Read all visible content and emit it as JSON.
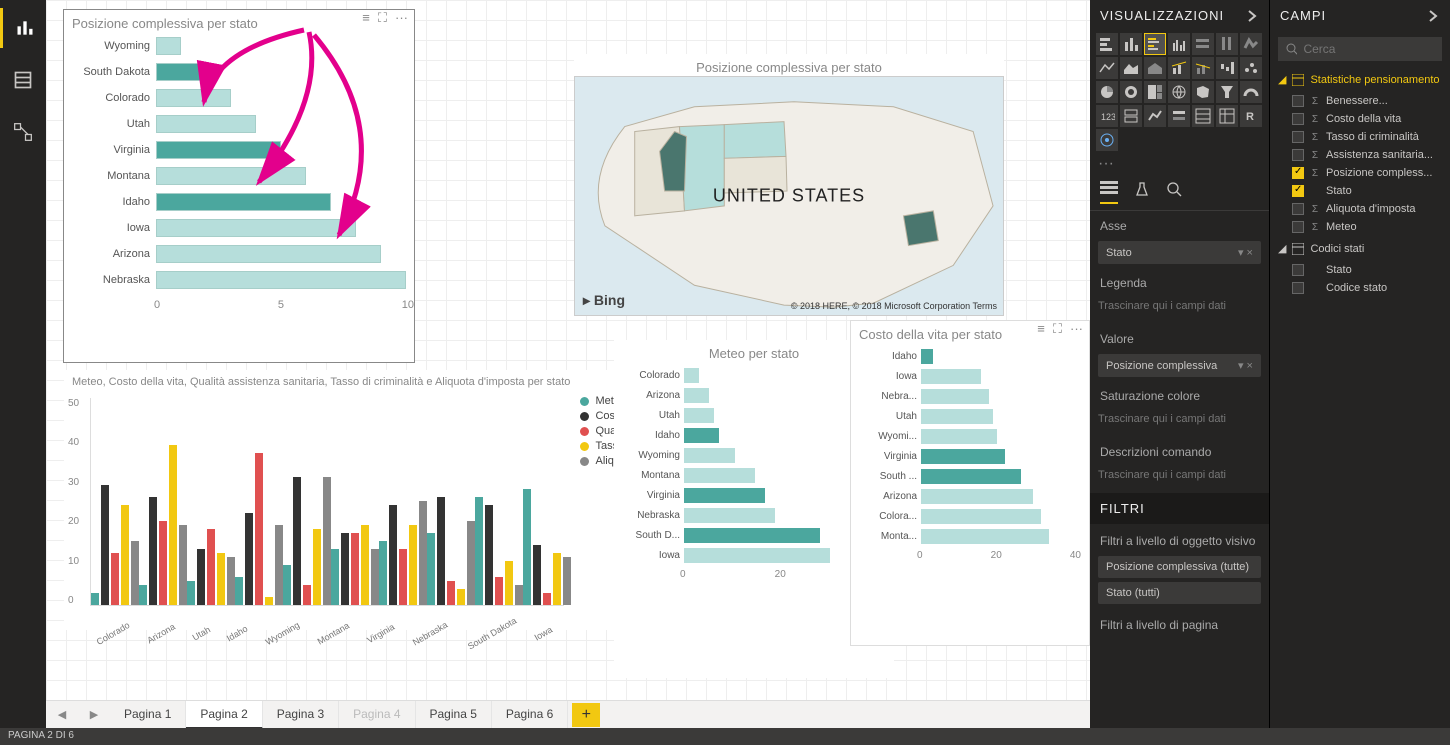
{
  "leftRail": {
    "items": [
      "report",
      "data",
      "model"
    ]
  },
  "visualizations": {
    "title": "VISUALIZZAZIONI",
    "more": "···"
  },
  "vizTabs": [
    "fields",
    "format",
    "analytics"
  ],
  "wells": {
    "axis": {
      "label": "Asse",
      "value": "Stato"
    },
    "legend": {
      "label": "Legenda",
      "placeholder": "Trascinare qui i campi dati"
    },
    "value": {
      "label": "Valore",
      "item": "Posizione complessiva"
    },
    "saturation": {
      "label": "Saturazione colore",
      "placeholder": "Trascinare qui i campi dati"
    },
    "tooltips": {
      "label": "Descrizioni comando",
      "placeholder": "Trascinare qui i campi dati"
    }
  },
  "filters": {
    "title": "FILTRI",
    "visualLevel": "Filtri a livello di oggetto visivo",
    "items": [
      "Posizione complessiva (tutte)",
      "Stato (tutti)"
    ],
    "pageLevel": "Filtri a livello di pagina"
  },
  "fieldsPanel": {
    "title": "CAMPI",
    "searchPlaceholder": "Cerca",
    "tables": [
      {
        "name": "Statistiche pensionamento",
        "highlight": true,
        "fields": [
          {
            "name": "Benessere...",
            "sigma": true,
            "checked": false
          },
          {
            "name": "Costo della vita",
            "sigma": true,
            "checked": false
          },
          {
            "name": "Tasso di criminalità",
            "sigma": true,
            "checked": false
          },
          {
            "name": "Assistenza sanitaria...",
            "sigma": true,
            "checked": false
          },
          {
            "name": "Posizione compless...",
            "sigma": true,
            "checked": true
          },
          {
            "name": "Stato",
            "sigma": false,
            "checked": true
          },
          {
            "name": "Aliquota d'imposta",
            "sigma": true,
            "checked": false
          },
          {
            "name": "Meteo",
            "sigma": true,
            "checked": false
          }
        ]
      },
      {
        "name": "Codici stati",
        "highlight": false,
        "fields": [
          {
            "name": "Stato",
            "sigma": false,
            "checked": false
          },
          {
            "name": "Codice stato",
            "sigma": false,
            "checked": false
          }
        ]
      }
    ]
  },
  "pageTabs": {
    "pages": [
      "Pagina 1",
      "Pagina 2",
      "Pagina 3",
      "Pagina 4",
      "Pagina 5",
      "Pagina 6"
    ],
    "active": 1,
    "dim": 3
  },
  "statusBar": "PAGINA 2 DI 6",
  "chart_data": [
    {
      "id": "pos_per_stato",
      "type": "bar",
      "orientation": "horizontal",
      "title": "Posizione complessiva per stato",
      "categories": [
        "Wyoming",
        "South Dakota",
        "Colorado",
        "Utah",
        "Virginia",
        "Montana",
        "Idaho",
        "Iowa",
        "Arizona",
        "Nebraska"
      ],
      "values": [
        1,
        2,
        3,
        4,
        5,
        6,
        7,
        8,
        9,
        10
      ],
      "highlight": [
        "South Dakota",
        "Virginia",
        "Idaho"
      ],
      "xlim": [
        0,
        10
      ],
      "xticks": [
        0,
        5,
        10
      ]
    },
    {
      "id": "map",
      "type": "map",
      "title": "Posizione complessiva per stato",
      "label": "UNITED STATES",
      "provider": "Bing",
      "credits": "© 2018 HERE, © 2018 Microsoft Corporation  Terms"
    },
    {
      "id": "multi_metric",
      "type": "bar",
      "orientation": "vertical",
      "title": "Meteo, Costo della vita, Qualità assistenza sanitaria, Tasso di criminalità e Aliquota d'imposta per stato",
      "categories": [
        "Colorado",
        "Arizona",
        "Utah",
        "Idaho",
        "Wyoming",
        "Montana",
        "Virginia",
        "Nebraska",
        "South Dakota",
        "Iowa"
      ],
      "series": [
        {
          "name": "Meteo",
          "color": "#4ba79e",
          "values": [
            3,
            5,
            6,
            7,
            10,
            14,
            16,
            18,
            27,
            29
          ]
        },
        {
          "name": "Costo della vita",
          "color": "#333333",
          "values": [
            30,
            27,
            14,
            23,
            32,
            18,
            25,
            27,
            25,
            15
          ]
        },
        {
          "name": "Qualità assistenza sanitaria",
          "color": "#e05050",
          "values": [
            13,
            21,
            19,
            38,
            5,
            18,
            14,
            6,
            7,
            3
          ]
        },
        {
          "name": "Tasso di criminalità",
          "color": "#f2c811",
          "values": [
            25,
            40,
            13,
            2,
            19,
            20,
            20,
            4,
            11,
            13
          ]
        },
        {
          "name": "Aliquota d'imposta",
          "color": "#888888",
          "values": [
            16,
            20,
            12,
            20,
            32,
            14,
            26,
            21,
            5,
            12
          ]
        }
      ],
      "ylim": [
        0,
        50
      ],
      "yticks": [
        0,
        10,
        20,
        30,
        40,
        50
      ]
    },
    {
      "id": "meteo_per_stato",
      "type": "bar",
      "orientation": "horizontal",
      "title": "Meteo per stato",
      "categories": [
        "Colorado",
        "Arizona",
        "Utah",
        "Idaho",
        "Wyoming",
        "Montana",
        "Virginia",
        "Nebraska",
        "South D...",
        "Iowa"
      ],
      "values": [
        3,
        5,
        6,
        7,
        10,
        14,
        16,
        18,
        27,
        29
      ],
      "highlight": [
        "Idaho",
        "Virginia",
        "South D..."
      ],
      "xlim": [
        0,
        40
      ],
      "xticks": [
        0,
        20,
        40
      ]
    },
    {
      "id": "costo_per_stato",
      "type": "bar",
      "orientation": "horizontal",
      "title": "Costo della vita per stato",
      "categories": [
        "Idaho",
        "Iowa",
        "Nebra...",
        "Utah",
        "Wyomi...",
        "Virginia",
        "South ...",
        "Arizona",
        "Colora...",
        "Monta..."
      ],
      "values": [
        3,
        15,
        17,
        18,
        19,
        21,
        25,
        28,
        30,
        32
      ],
      "highlight": [
        "Idaho",
        "Virginia",
        "South ..."
      ],
      "xlim": [
        0,
        40
      ],
      "xticks": [
        0,
        20,
        40
      ]
    }
  ]
}
